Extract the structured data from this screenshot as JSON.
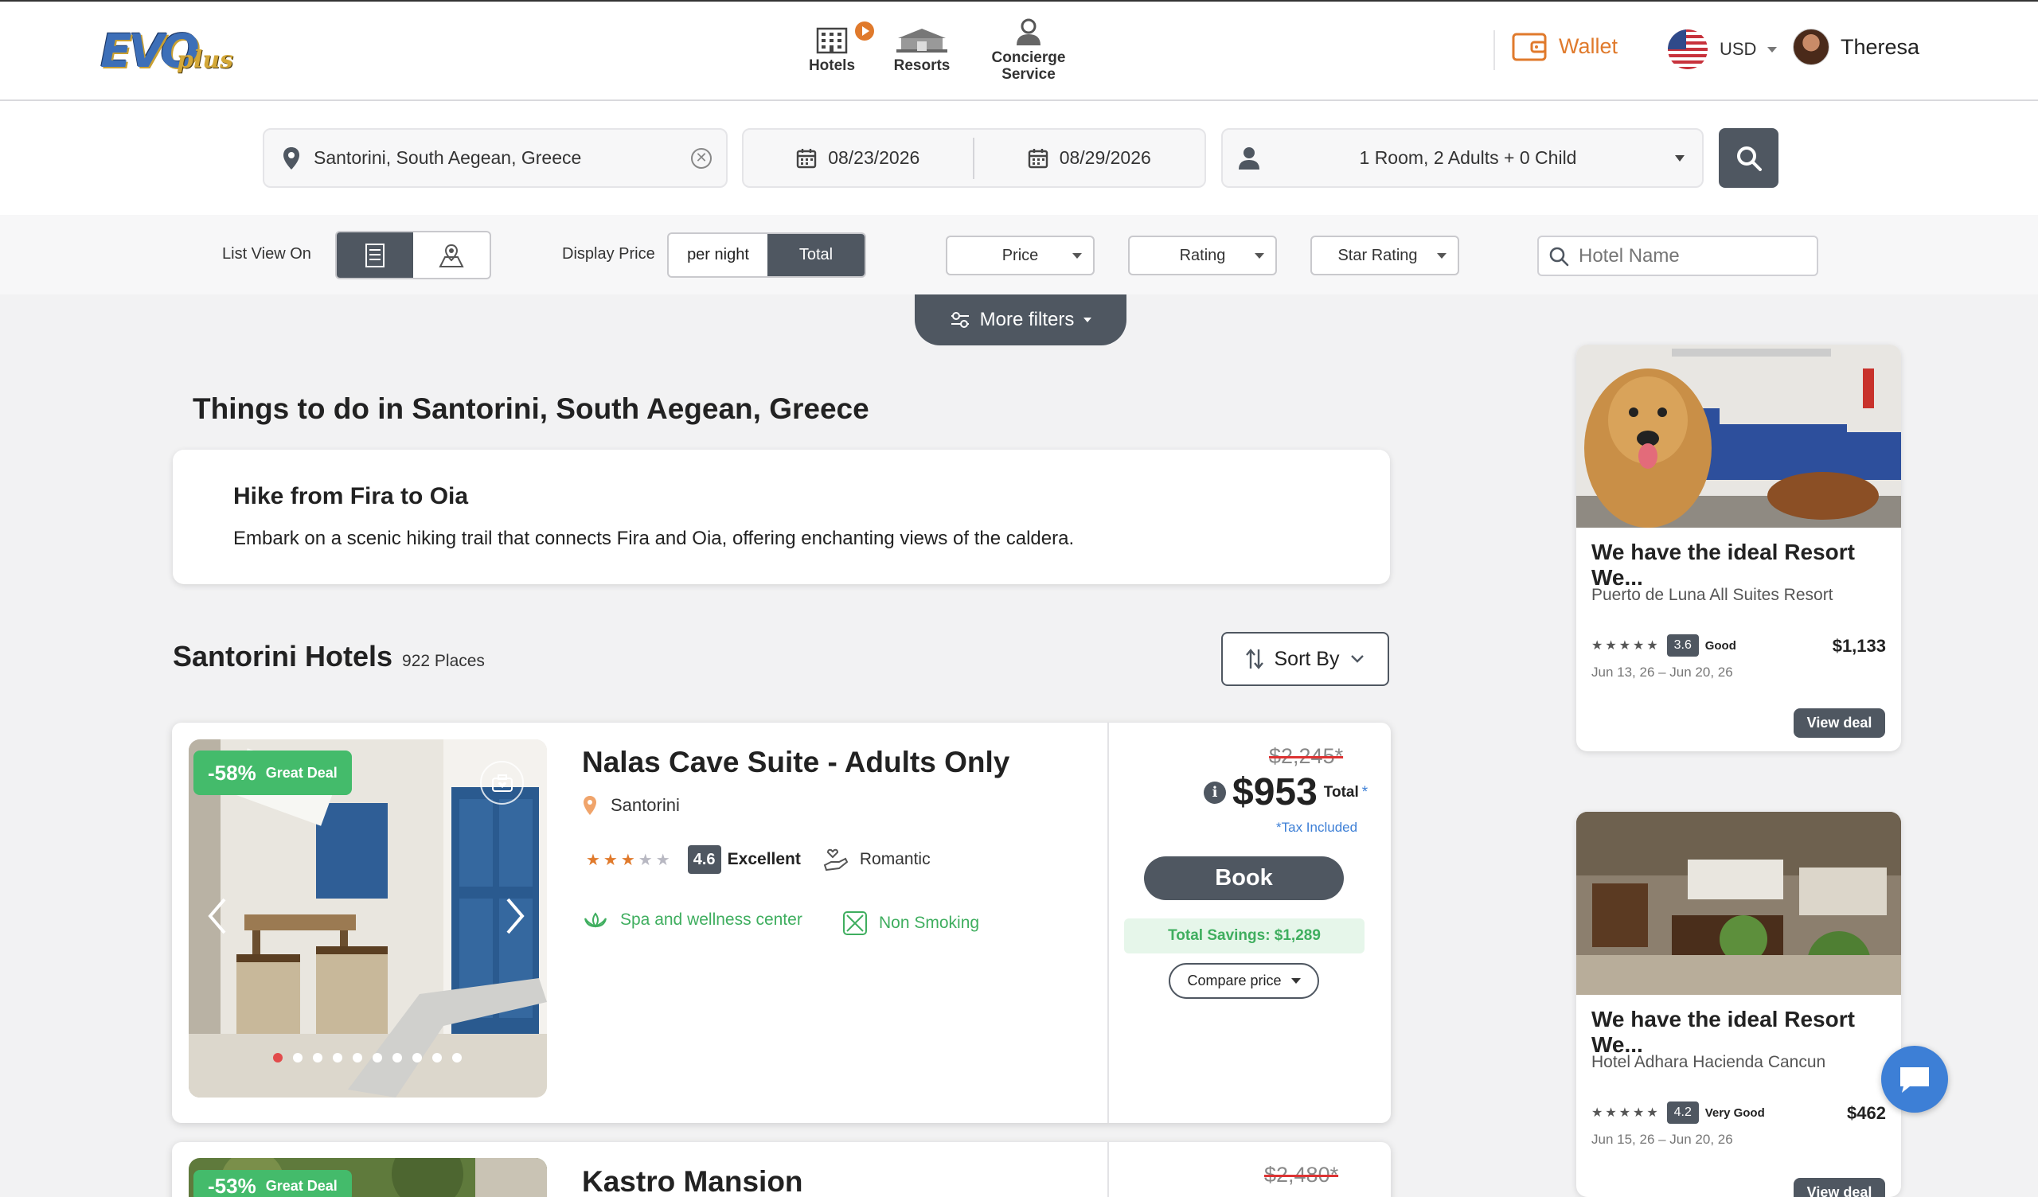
{
  "header": {
    "nav": [
      {
        "label": "Hotels"
      },
      {
        "label": "Resorts"
      },
      {
        "label": "Concierge",
        "label2": "Service"
      }
    ],
    "wallet_label": "Wallet",
    "currency": "USD",
    "user_name": "Theresa"
  },
  "search": {
    "destination": "Santorini, South Aegean, Greece",
    "checkin": "08/23/2026",
    "checkout": "08/29/2026",
    "guests": "1 Room, 2 Adults + 0 Child"
  },
  "filters": {
    "list_view_label": "List View On",
    "display_price_label": "Display Price",
    "per_night": "per night",
    "total": "Total",
    "price": "Price",
    "rating": "Rating",
    "star_rating": "Star Rating",
    "hotel_name_placeholder": "Hotel Name",
    "more_filters": "More filters"
  },
  "things_to_do": {
    "title": "Things to do in Santorini, South Aegean, Greece",
    "activity_title": "Hike from Fira to Oia",
    "activity_desc": "Embark on a scenic hiking trail that connects Fira and Oia, offering enchanting views of the caldera."
  },
  "hotels_section": {
    "title": "Santorini Hotels",
    "count": "922 Places",
    "sort_by": "Sort By"
  },
  "hotels": [
    {
      "discount": "-58%",
      "deal_label": "Great Deal",
      "name": "Nalas Cave Suite - Adults Only",
      "location": "Santorini",
      "stars": 3,
      "rating": "4.6",
      "rating_text": "Excellent",
      "tag": "Romantic",
      "amenities": [
        "Spa and wellness center",
        "Non Smoking"
      ],
      "old_price": "$2,245*",
      "price": "$953",
      "price_suffix": "Total",
      "asterisk": "*",
      "tax_note": "*Tax Included",
      "book_label": "Book",
      "savings": "Total Savings: $1,289",
      "compare_label": "Compare price"
    },
    {
      "discount": "-53%",
      "deal_label": "Great Deal",
      "name": "Kastro Mansion",
      "old_price": "$2,480*"
    }
  ],
  "ads": [
    {
      "title": "We have the ideal Resort We...",
      "subtitle": "Puerto de Luna All Suites Resort",
      "rating": "3.6",
      "rating_text": "Good",
      "price": "$1,133",
      "dates": "Jun 13, 26 – Jun 20, 26",
      "cta": "View deal"
    },
    {
      "title": "We have the ideal Resort We...",
      "subtitle": "Hotel Adhara Hacienda Cancun",
      "rating": "4.2",
      "rating_text": "Very Good",
      "price": "$462",
      "dates": "Jun 15, 26 – Jun 20, 26",
      "cta": "View deal"
    }
  ],
  "colors": {
    "accent_orange": "#e07a2c",
    "primary_dark": "#4f5761",
    "deal_green": "#44bb6b",
    "tax_blue": "#3d7fd6"
  }
}
